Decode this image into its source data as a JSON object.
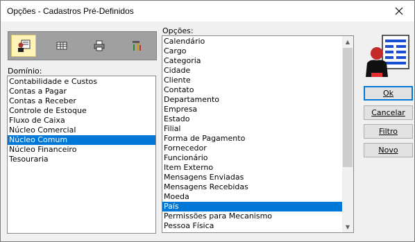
{
  "window": {
    "title": "Opções - Cadastros Pré-Definidos"
  },
  "toolbar": {
    "buttons": [
      {
        "icon": "user-card-icon",
        "active": true
      },
      {
        "icon": "spreadsheet-icon",
        "active": false
      },
      {
        "icon": "printer-icon",
        "active": false
      },
      {
        "icon": "tools-icon",
        "active": false
      }
    ]
  },
  "dominio": {
    "label": "Domínio:",
    "items": [
      "Contabilidade e Custos",
      "Contas a Pagar",
      "Contas a Receber",
      "Controle de Estoque",
      "Fluxo de Caixa",
      "Núcleo Comercial",
      "Núcleo Comum",
      "Núcleo Financeiro",
      "Tesouraria"
    ],
    "selected": "Núcleo Comum"
  },
  "opcoes": {
    "label": "Opções:",
    "items": [
      "Calendário",
      "Cargo",
      "Categoria",
      "Cidade",
      "Cliente",
      "Contato",
      "Departamento",
      "Empresa",
      "Estado",
      "Filial",
      "Forma de Pagamento",
      "Fornecedor",
      "Funcionário",
      "Item Externo",
      "Mensagens Enviadas",
      "Mensagens Recebidas",
      "Moeda",
      "País",
      "Permissões para Mecanismo",
      "Pessoa Física"
    ],
    "selected": "País"
  },
  "buttons": {
    "ok": "Ok",
    "cancelar": "Cancelar",
    "filtro": "Filtro",
    "novo": "Novo"
  },
  "colors": {
    "selection": "#0078d7",
    "active_tool": "#fff3b8"
  }
}
